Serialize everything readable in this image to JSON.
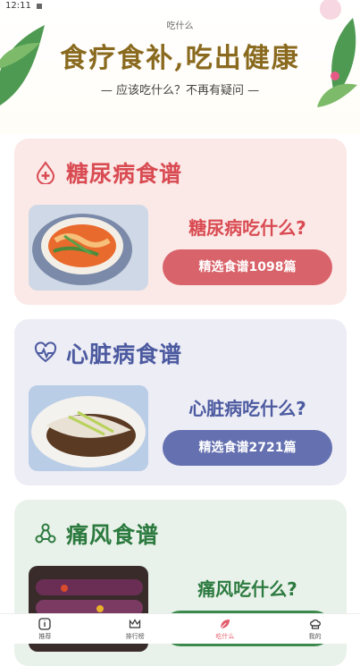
{
  "status": {
    "time": "12:11"
  },
  "header": {
    "app_name": "吃什么",
    "headline": "食疗食补,吃出健康",
    "subtitle": "— 应该吃什么？不再有疑问 —"
  },
  "cards": [
    {
      "title": "糖尿病食谱",
      "question": "糖尿病吃什么?",
      "button": "精选食谱1098篇",
      "accent": "#d94b52",
      "bg": "#fbe9e8",
      "button_color": "#d9636a"
    },
    {
      "title": "心脏病食谱",
      "question": "心脏病吃什么?",
      "button": "精选食谱2721篇",
      "accent": "#4c5aa0",
      "bg": "#ededf5",
      "button_color": "#6470b0"
    },
    {
      "title": "痛风食谱",
      "question": "痛风吃什么?",
      "button": "",
      "accent": "#2c7a3f",
      "bg": "#e9f2ea",
      "button_color": "#3b8a4d"
    }
  ],
  "tabs": [
    {
      "label": "推荐",
      "icon": "info-icon",
      "active": false
    },
    {
      "label": "排行榜",
      "icon": "crown-icon",
      "active": false
    },
    {
      "label": "吃什么",
      "icon": "leaf-icon",
      "active": true
    },
    {
      "label": "我的",
      "icon": "chef-hat-icon",
      "active": false
    }
  ]
}
